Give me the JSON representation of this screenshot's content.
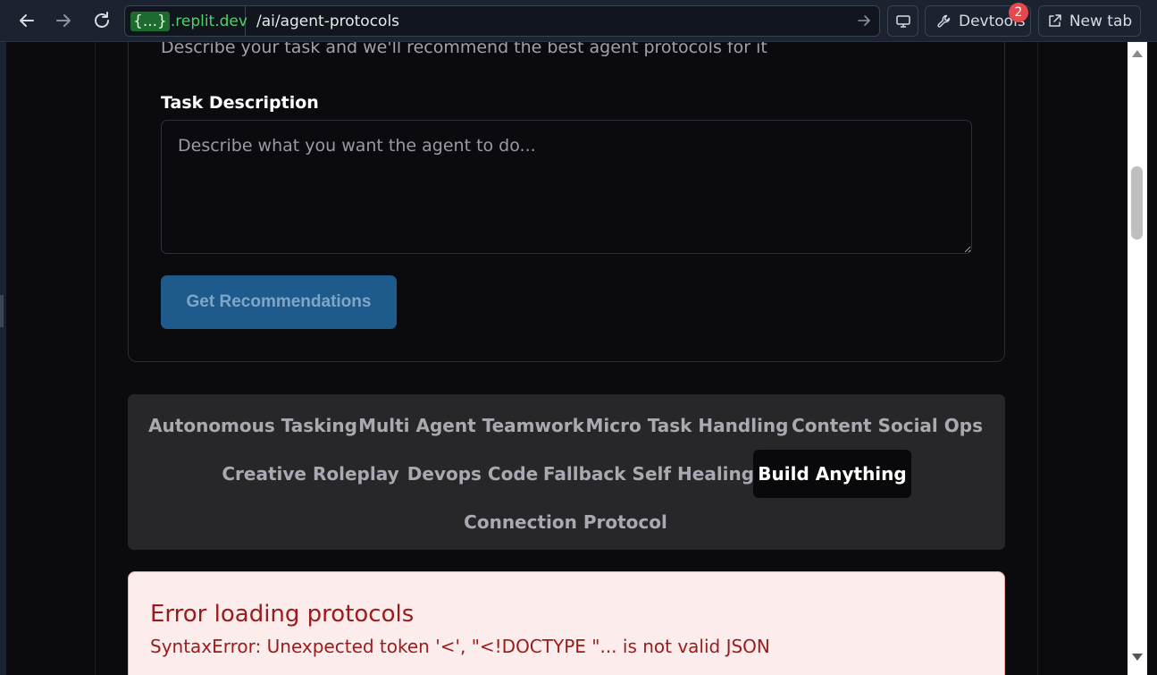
{
  "browser": {
    "host_badge": "{...}",
    "host": ".replit.dev",
    "path": "/ai/agent-protocols",
    "devtools_label": "Devtools",
    "devtools_count": "2",
    "newtab_label": "New tab"
  },
  "form": {
    "subtitle": "Describe your task and we'll recommend the best agent protocols for it",
    "label": "Task Description",
    "placeholder": "Describe what you want the agent to do...",
    "button": "Get Recommendations"
  },
  "tabs": [
    {
      "label": "Autonomous Tasking"
    },
    {
      "label": "Multi Agent Teamwork"
    },
    {
      "label": "Micro Task Handling"
    },
    {
      "label": "Content Social Ops"
    },
    {
      "label": "Creative Roleplay"
    },
    {
      "label": "Devops Code"
    },
    {
      "label": "Fallback Self Healing"
    },
    {
      "label": "Build Anything"
    },
    {
      "label": "Connection Protocol"
    }
  ],
  "active_tab": "Build Anything",
  "error": {
    "title": "Error loading protocols",
    "message": "SyntaxError: Unexpected token '<', \"<!DOCTYPE \"... is not valid JSON"
  },
  "colors": {
    "accent": "#1f5a8c",
    "error_text": "#991b1b",
    "error_bg": "#fdecec"
  }
}
